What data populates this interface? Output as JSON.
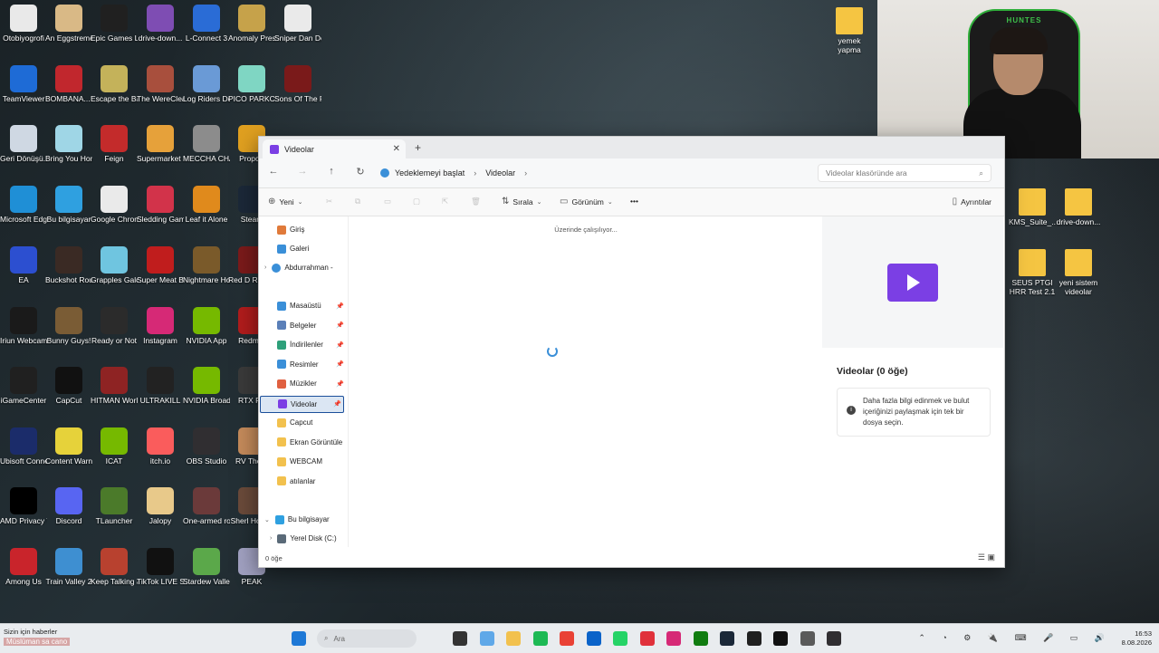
{
  "desktop": {
    "icons_col1": [
      {
        "label": "Otobiyogrofi",
        "color": "#e9e9e9"
      },
      {
        "label": "TeamViewer",
        "color": "#1e6bd6"
      },
      {
        "label": "Geri Dönüşü...",
        "color": "#cfd8e3"
      },
      {
        "label": "Microsoft Edge",
        "color": "#1f8fd6"
      },
      {
        "label": "EA",
        "color": "#2c4fd0"
      },
      {
        "label": "Iriun Webcam",
        "color": "#1a1a1a"
      },
      {
        "label": "iGameCenter",
        "color": "#202020"
      },
      {
        "label": "Ubisoft Connect",
        "color": "#1b2c6a"
      },
      {
        "label": "AMD Privacy View",
        "color": "#000000"
      },
      {
        "label": "Among Us",
        "color": "#c9242b"
      }
    ],
    "icons_col2": [
      {
        "label": "An Eggstreme...",
        "color": "#d9b986"
      },
      {
        "label": "BOMBANA... Demo",
        "color": "#c1272d"
      },
      {
        "label": "Bring You Home",
        "color": "#9fd6e6"
      },
      {
        "label": "Bu bilgisayar",
        "color": "#2fa0e0"
      },
      {
        "label": "Buckshot Roulette",
        "color": "#3a2a24"
      },
      {
        "label": "Bunny Guys!",
        "color": "#7a5c35"
      },
      {
        "label": "CapCut",
        "color": "#111111"
      },
      {
        "label": "Content Warning",
        "color": "#e6d23a"
      },
      {
        "label": "Discord",
        "color": "#5865f2"
      },
      {
        "label": "Train Valley 2",
        "color": "#3e8fd1"
      }
    ],
    "icons_col3": [
      {
        "label": "Epic Games Launcher",
        "color": "#202020"
      },
      {
        "label": "Escape the Backrooms",
        "color": "#c4b25a"
      },
      {
        "label": "Feign",
        "color": "#c32b2b"
      },
      {
        "label": "Google Chrome",
        "color": "#eaeaea"
      },
      {
        "label": "Grapples Galore",
        "color": "#6fc5e0"
      },
      {
        "label": "Ready or Not",
        "color": "#2b2b2b"
      },
      {
        "label": "HITMAN World of As...",
        "color": "#8e2323"
      },
      {
        "label": "ICAT",
        "color": "#76b900"
      },
      {
        "label": "TLauncher",
        "color": "#4b7a2a"
      },
      {
        "label": "Keep Talking and Nobo...",
        "color": "#b8412f"
      }
    ],
    "icons_col4": [
      {
        "label": "drive-down...",
        "color": "#7e4db3"
      },
      {
        "label": "The WereCleaner",
        "color": "#a84f3d"
      },
      {
        "label": "Supermarket Simulator",
        "color": "#e6a13a"
      },
      {
        "label": "Sledding Game",
        "color": "#d2334a"
      },
      {
        "label": "Super Meat Boy",
        "color": "#c01d1d"
      },
      {
        "label": "Instagram",
        "color": "#d62976"
      },
      {
        "label": "ULTRAKILL",
        "color": "#222222"
      },
      {
        "label": "itch.io",
        "color": "#fa5c5c"
      },
      {
        "label": "Jalopy",
        "color": "#e8c98a"
      },
      {
        "label": "TikTok LIVE Studio",
        "color": "#111111"
      }
    ],
    "icons_col5": [
      {
        "label": "L-Connect 3",
        "color": "#2a6cd6"
      },
      {
        "label": "Log Riders Demo",
        "color": "#6a9ad6"
      },
      {
        "label": "MECCHA CHAMELEON",
        "color": "#8c8c8c"
      },
      {
        "label": "Leaf it Alone",
        "color": "#e08a1c"
      },
      {
        "label": "Nightmare House The ...",
        "color": "#7a5a2a"
      },
      {
        "label": "NVIDIA App",
        "color": "#76b900"
      },
      {
        "label": "NVIDIA Broadcast",
        "color": "#76b900"
      },
      {
        "label": "OBS Studio",
        "color": "#302e31"
      },
      {
        "label": "One-armed robber",
        "color": "#6b3a3a"
      },
      {
        "label": "Stardew Valley",
        "color": "#5ba84a"
      }
    ],
    "icons_col6": [
      {
        "label": "Anomaly President",
        "color": "#c6a24a"
      },
      {
        "label": "PICO PARKClass...",
        "color": "#7fd6c3"
      },
      {
        "label": "Proport",
        "color": "#e0a020"
      },
      {
        "label": "Steam",
        "color": "#1b2838"
      },
      {
        "label": "Red D Redem",
        "color": "#7a1a1a"
      },
      {
        "label": "Redmat",
        "color": "#b01c1c"
      },
      {
        "label": "RTX Re",
        "color": "#3a3a3a"
      },
      {
        "label": "RV There",
        "color": "#c48a5a"
      },
      {
        "label": "Sherl Holme",
        "color": "#6a4a3a"
      },
      {
        "label": "PEAK",
        "color": "#a0a0c0"
      }
    ],
    "icons_col7": [
      {
        "label": "Sniper Dan Demo",
        "color": "#eaeaea"
      },
      {
        "label": "Sons Of The Forest",
        "color": "#7a1a1a"
      }
    ],
    "right_icons": [
      {
        "label": "yemek yapma",
        "color": "#f5c542"
      },
      {
        "label": "KMS_Suite_...",
        "color": "#f5c542"
      },
      {
        "label": "drive-down...",
        "color": "#f5c542"
      },
      {
        "label": "SEUS PTGI HRR Test 2.1",
        "color": "#f5c542"
      },
      {
        "label": "yeni sistem videolar",
        "color": "#f5c542"
      }
    ]
  },
  "webcam": {
    "brand": "HUNTES"
  },
  "explorer": {
    "tab_title": "Videolar",
    "tab_close": "✕",
    "new_tab": "+",
    "breadcrumb": {
      "root": "Yedeklemeyi başlat",
      "current": "Videolar"
    },
    "search_placeholder": "Videolar klasöründe ara",
    "toolbar": {
      "new": "Yeni",
      "sort": "Sırala",
      "view": "Görünüm",
      "more": "•••",
      "details": "Ayrıntılar"
    },
    "sidebar": {
      "home": "Giriş",
      "gallery": "Galeri",
      "cloud": "Abdurrahman -",
      "pinned": [
        {
          "label": "Masaüstü",
          "color": "#3a8fd8"
        },
        {
          "label": "Belgeler",
          "color": "#5a7fb8"
        },
        {
          "label": "İndirilenler",
          "color": "#2ea07a"
        },
        {
          "label": "Resimler",
          "color": "#3a8fd8"
        },
        {
          "label": "Müzikler",
          "color": "#e06040"
        },
        {
          "label": "Videolar",
          "color": "#7b3fe4"
        }
      ],
      "folders": [
        "Capcut",
        "Ekran Görüntüle",
        "WEBCAM",
        "atılanlar"
      ],
      "this_pc": "Bu bilgisayar",
      "local_disk": "Yerel Disk (C:)"
    },
    "working_text": "Üzerinde çalışılıyor...",
    "details_title": "Videolar (0 öğe)",
    "details_info": "Daha fazla bilgi edinmek ve bulut içeriğinizi paylaşmak için tek bir dosya seçin.",
    "status_count": "0 öğe"
  },
  "taskbar": {
    "news_line1": "Sizin için haberler",
    "news_line2": "Müslüman sa cano",
    "search_placeholder": "Ara",
    "time": "16:53",
    "date": "8.08.2026",
    "icons": [
      "explorer-icon",
      "copilot-icon",
      "folder-icon",
      "spotify-icon",
      "chrome-icon",
      "store-icon",
      "whatsapp-icon",
      "opera-icon",
      "instagram-icon",
      "xbox-icon",
      "steam-icon",
      "epic-icon",
      "capcut-icon",
      "settings-icon",
      "obs-icon"
    ],
    "icon_colors": [
      "#333333",
      "#5fa8e8",
      "#f2c14e",
      "#1db954",
      "#e94235",
      "#0a63c9",
      "#25d366",
      "#e0313b",
      "#d62976",
      "#107c10",
      "#1b2838",
      "#202020",
      "#111111",
      "#5a5a5a",
      "#302e31"
    ]
  }
}
